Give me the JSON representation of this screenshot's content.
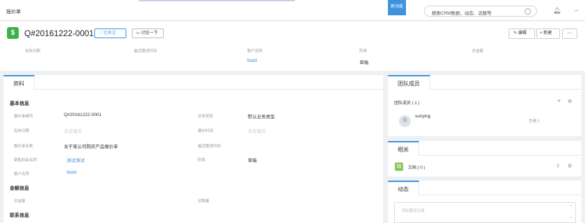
{
  "topbar": {
    "breadcrumb": "报价单",
    "new_badge": "新功能",
    "search_placeholder": "搜索CRM数据、动态、话题等",
    "icons": [
      "search-icon",
      "bell-icon",
      "more-icon"
    ]
  },
  "header": {
    "title": "Q#20161222-0001",
    "follow_label": "已关注",
    "discuss_label": "讨论一下",
    "edit_label": "编辑",
    "new_label": "新建",
    "more_label": "···",
    "fields": [
      {
        "label": "有效日期",
        "value": ""
      },
      {
        "label": "最近跟进时间",
        "value": ""
      },
      {
        "label": "客户名称",
        "value": "fdafd"
      },
      {
        "label": "阶段",
        "value": "草稿"
      },
      {
        "label": "总金额",
        "value": ""
      }
    ]
  },
  "main": {
    "tab_label": "资料",
    "basic": {
      "title": "基本信息",
      "rows": [
        {
          "l1": "报价单编号",
          "v1": "Q#20161222-0001",
          "l2": "业务类型",
          "v2": "默认业务类型"
        },
        {
          "l1": "有效日期",
          "v1": "点击填写",
          "l2": "报价时间",
          "v2": "点击填写"
        },
        {
          "l1": "报价单名称",
          "v1": "关于某公司购买产品报价单",
          "l2": "最近跟进时间",
          "v2": ""
        },
        {
          "l1": "销售机会名称",
          "v1": "测试测试",
          "l2": "阶段",
          "v2": "草稿"
        },
        {
          "l1": "客户名称",
          "v1": "fdafd",
          "l2": "",
          "v2": ""
        }
      ]
    },
    "amount": {
      "title": "金额信息",
      "l1": "总金额",
      "l2": "总数量"
    },
    "contact": {
      "title": "联系信息"
    }
  },
  "side": {
    "team_tab": "团队成员",
    "team_count": "团队成员 ( 1 )",
    "member_name": "sunying",
    "member_role": "负责人",
    "related_tab": "相关",
    "docs_label": "文档 ( 0 )",
    "activity_tab": "动态",
    "activity_placeholder": "添加跟进记录"
  },
  "colors": {
    "accent": "#3d93dc",
    "green": "#3bb346"
  }
}
